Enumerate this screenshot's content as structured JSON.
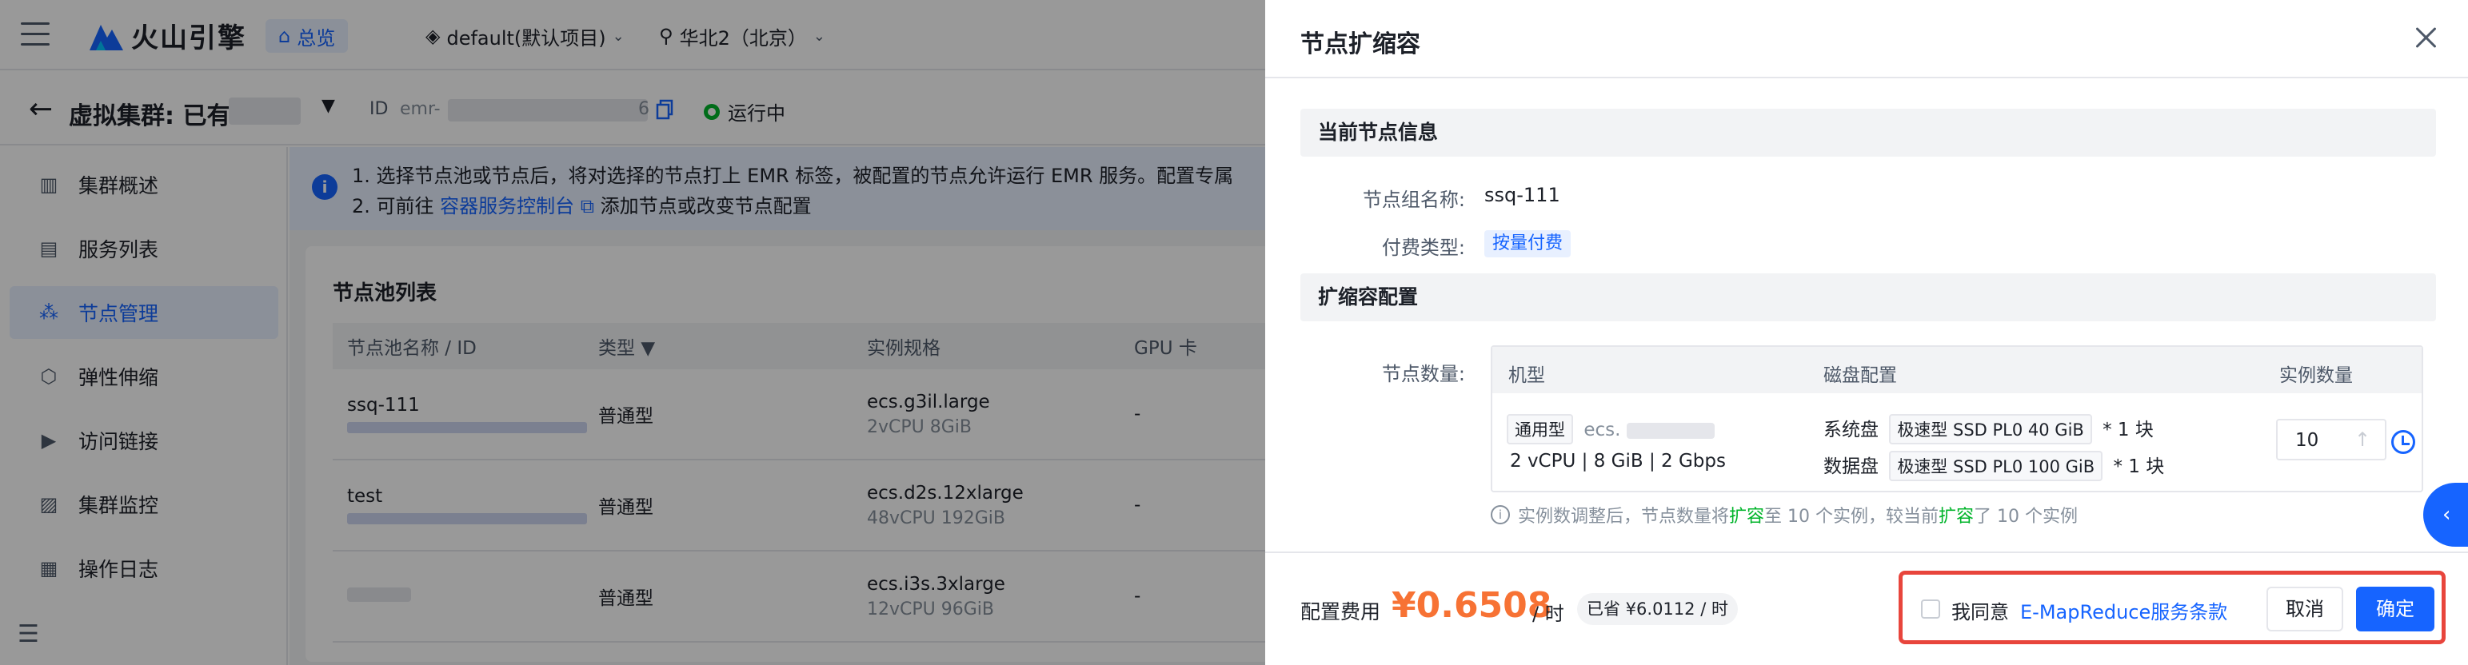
{
  "topbar": {
    "brand": "火山引擎",
    "home_label": "总览",
    "project": "default(默认项目)",
    "region": "华北2（北京）"
  },
  "cluster": {
    "title": "虚拟集群:  已有",
    "id_label": "ID",
    "id_prefix": "emr-",
    "id_suffix": "6",
    "status": "运行中"
  },
  "sidebar": {
    "items": [
      {
        "label": "集群概述",
        "icon": "bar-chart-icon"
      },
      {
        "label": "服务列表",
        "icon": "list-icon"
      },
      {
        "label": "节点管理",
        "icon": "nodes-icon"
      },
      {
        "label": "弹性伸缩",
        "icon": "scale-icon"
      },
      {
        "label": "访问链接",
        "icon": "link-icon"
      },
      {
        "label": "集群监控",
        "icon": "monitor-icon"
      },
      {
        "label": "操作日志",
        "icon": "log-icon"
      }
    ]
  },
  "alert": {
    "line1": "1. 选择节点池或节点后，将对选择的节点打上 EMR 标签，被配置的节点允许运行 EMR 服务。配置专属",
    "line2_prefix": "2. 可前往",
    "line2_link": "容器服务控制台",
    "line2_suffix": "添加节点或改变节点配置"
  },
  "pool": {
    "title": "节点池列表",
    "headers": [
      "节点池名称 / ID",
      "类型",
      "实例规格",
      "GPU 卡"
    ],
    "rows": [
      {
        "name": "ssq-111",
        "type": "普通型",
        "spec": "ecs.g3il.large",
        "spec_sub": "2vCPU 8GiB",
        "gpu": "-"
      },
      {
        "name": "test",
        "type": "普通型",
        "spec": "ecs.d2s.12xlarge",
        "spec_sub": "48vCPU 192GiB",
        "gpu": "-"
      },
      {
        "name": "",
        "type": "普通型",
        "spec": "ecs.i3s.3xlarge",
        "spec_sub": "12vCPU 96GiB",
        "gpu": "-"
      }
    ]
  },
  "drawer": {
    "title": "节点扩缩容",
    "current_section": "当前节点信息",
    "group_label": "节点组名称:",
    "group_value": "ssq-111",
    "pay_label": "付费类型:",
    "pay_value": "按量付费",
    "scale_section": "扩缩容配置",
    "count_label": "节点数量:",
    "table_headers": [
      "机型",
      "磁盘配置",
      "实例数量"
    ],
    "machine_tag": "通用型",
    "machine_prefix": "ecs.",
    "machine_spec": "2 vCPU  |  8 GiB  |  2 Gbps",
    "disk_sys_label": "系统盘",
    "disk_sys_tag": "极速型 SSD PL0 40 GiB",
    "disk_sys_count": "* 1 块",
    "disk_data_label": "数据盘",
    "disk_data_tag": "极速型 SSD PL0 100 GiB",
    "disk_data_count": "* 1 块",
    "instance_count": "10",
    "hint_a": "实例数调整后，节点数量将",
    "hint_b": "扩容",
    "hint_c": "至 10 个实例，较当前",
    "hint_d": "扩容",
    "hint_e": "了 10 个实例"
  },
  "footer": {
    "fee_label": "配置费用",
    "fee_value": "¥0.6508",
    "fee_unit": "/ 时",
    "saved": "已省 ¥6.0112 / 时",
    "agree_text": "我同意",
    "agree_link": "E-MapReduce服务条款",
    "cancel": "取消",
    "confirm": "确定"
  },
  "colors": {
    "primary": "#1664ff",
    "fee": "#f77234",
    "success": "#00b42a",
    "highlight": "#e8453c"
  }
}
